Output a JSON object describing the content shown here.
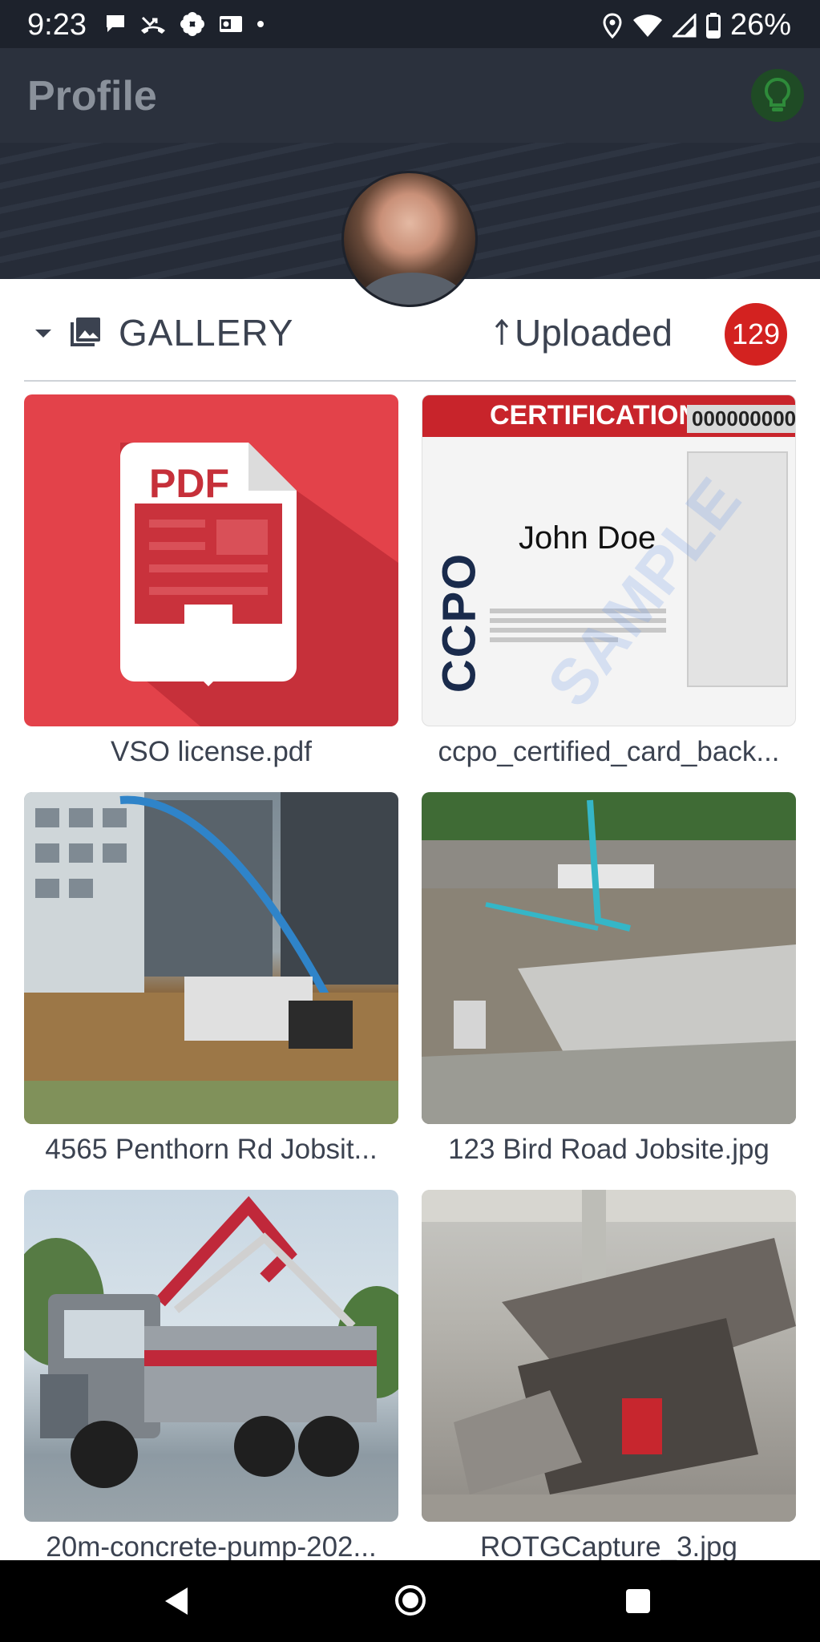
{
  "status_bar": {
    "time": "9:23",
    "battery": "26%",
    "notification_icons": [
      "chat-bubble-icon",
      "missed-call-icon",
      "pinwheel-icon",
      "outlook-mail-icon",
      "dot-icon"
    ],
    "system_icons": [
      "location-icon",
      "wifi-icon",
      "signal-icon",
      "battery-icon"
    ]
  },
  "app_bar": {
    "title": "Profile",
    "action_icon": "lightbulb-icon"
  },
  "gallery": {
    "title": "GALLERY",
    "sort_label": "Uploaded",
    "sort_direction_icon": "arrow-up-icon",
    "count": "129",
    "items": [
      {
        "caption": "VSO license.pdf",
        "kind": "pdf"
      },
      {
        "caption": "ccpo_certified_card_back...",
        "kind": "certificate-card",
        "card_header": "CERTIFICATION",
        "card_number": "000000000",
        "card_name": "John Doe",
        "card_logo": "CCPO",
        "watermark": "SAMPLE"
      },
      {
        "caption": "4565 Penthorn Rd Jobsit...",
        "kind": "photo-construction-site"
      },
      {
        "caption": "123 Bird Road Jobsite.jpg",
        "kind": "photo-aerial-jobsite"
      },
      {
        "caption": "20m-concrete-pump-202...",
        "kind": "photo-concrete-pump-truck"
      },
      {
        "caption": "ROTGCapture_3.jpg",
        "kind": "photo-damaged-equipment"
      }
    ]
  },
  "pdf_badge_text": "PDF",
  "colors": {
    "status_bar": "#1d222c",
    "app_bar": "#2b313d",
    "accent_red": "#d32220",
    "pdf_red": "#e3424a",
    "text": "#3b4250",
    "tip_button": "#1f4b25"
  }
}
